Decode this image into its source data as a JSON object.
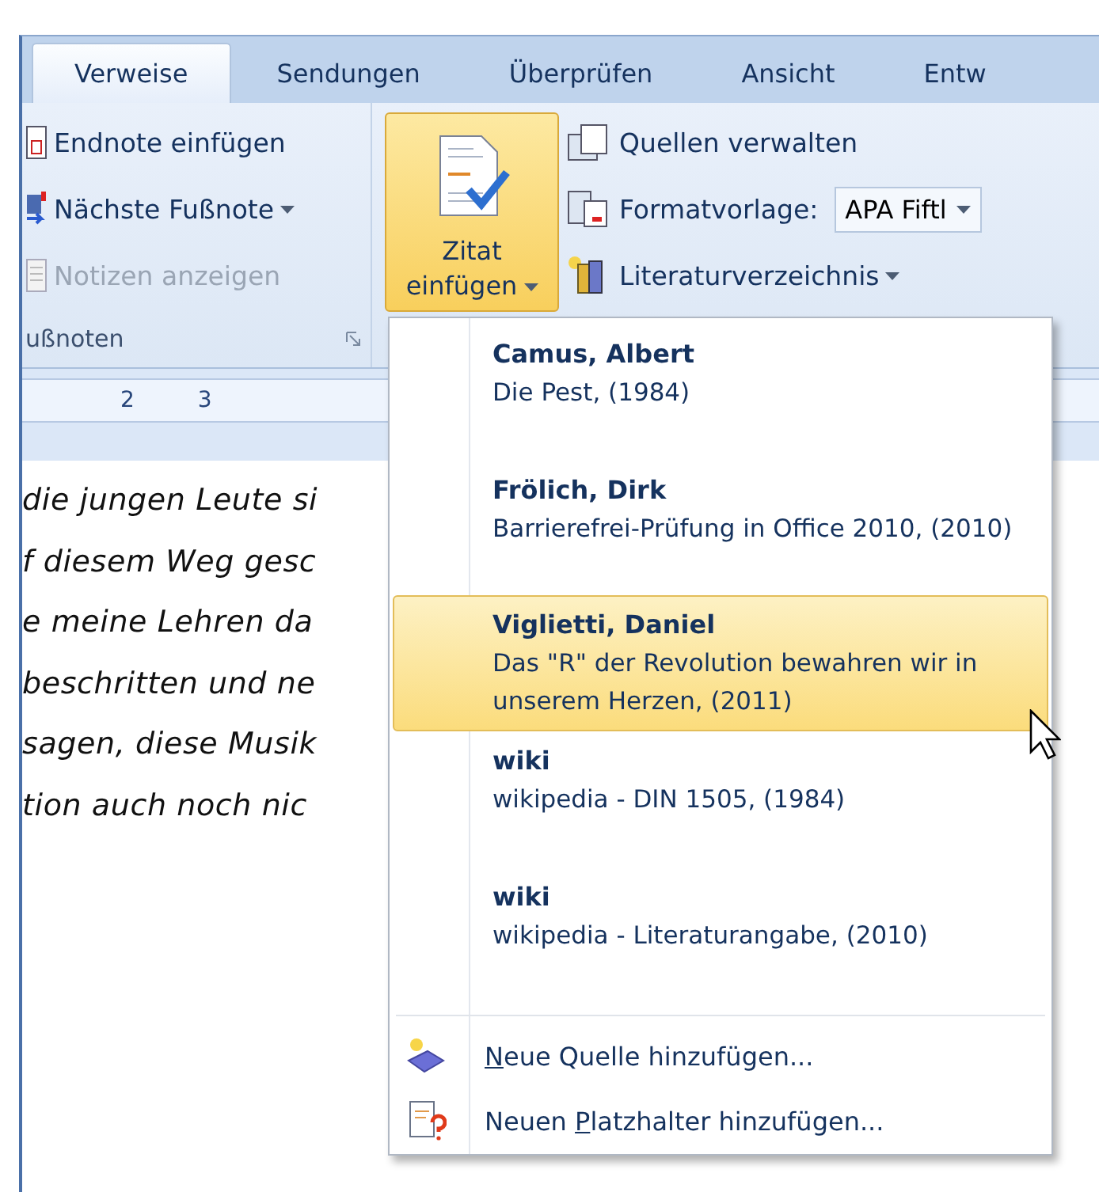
{
  "tabs": [
    {
      "label": "Verweise",
      "selected": true
    },
    {
      "label": "Sendungen",
      "selected": false
    },
    {
      "label": "Überprüfen",
      "selected": false
    },
    {
      "label": "Ansicht",
      "selected": false
    },
    {
      "label": "Entw",
      "selected": false
    }
  ],
  "footnotes_group": {
    "label": "ußnoten",
    "items": [
      {
        "label": "Endnote einfügen",
        "dropdown": false,
        "disabled": false
      },
      {
        "label": "Nächste Fußnote",
        "dropdown": true,
        "disabled": false
      },
      {
        "label": "Notizen anzeigen",
        "dropdown": false,
        "disabled": true
      }
    ]
  },
  "citation_group": {
    "insert_button": {
      "label_line1": "Zitat",
      "label_line2": "einfügen",
      "pressed": true
    },
    "manage_sources": {
      "label": "Quellen verwalten"
    },
    "style": {
      "label": "Formatvorlage:",
      "value": "APA Fiftl"
    },
    "bibliography": {
      "label": "Literaturverzeichnis"
    }
  },
  "ruler_numbers": [
    "2",
    "3"
  ],
  "document_lines": [
    "die jungen Leute si",
    "f diesem Weg gesc",
    "e meine Lehren da",
    "beschritten und ne",
    "sagen, diese Musik",
    "tion auch noch nic"
  ],
  "sources": [
    {
      "author": "Camus, Albert",
      "title": "Die Pest, (1984)",
      "selected": false
    },
    {
      "author": "Frölich, Dirk",
      "title": "Barrierefrei-Prüfung in Office 2010, (2010)",
      "selected": false
    },
    {
      "author": "Viglietti, Daniel",
      "title": "Das \"R\" der Revolution bewahren wir in unserem Herzen, (2011)",
      "selected": true
    },
    {
      "author": "wiki",
      "title": "wikipedia - DIN 1505, (1984)",
      "selected": false
    },
    {
      "author": "wiki",
      "title": "wikipedia - Literaturangabe, (2010)",
      "selected": false
    }
  ],
  "actions": [
    {
      "kind": "new-source",
      "access_key": "N",
      "after": "eue Quelle hinzufügen..."
    },
    {
      "kind": "placeholder",
      "before": "Neuen ",
      "access_key": "P",
      "after": "latzhalter hinzufügen..."
    }
  ]
}
